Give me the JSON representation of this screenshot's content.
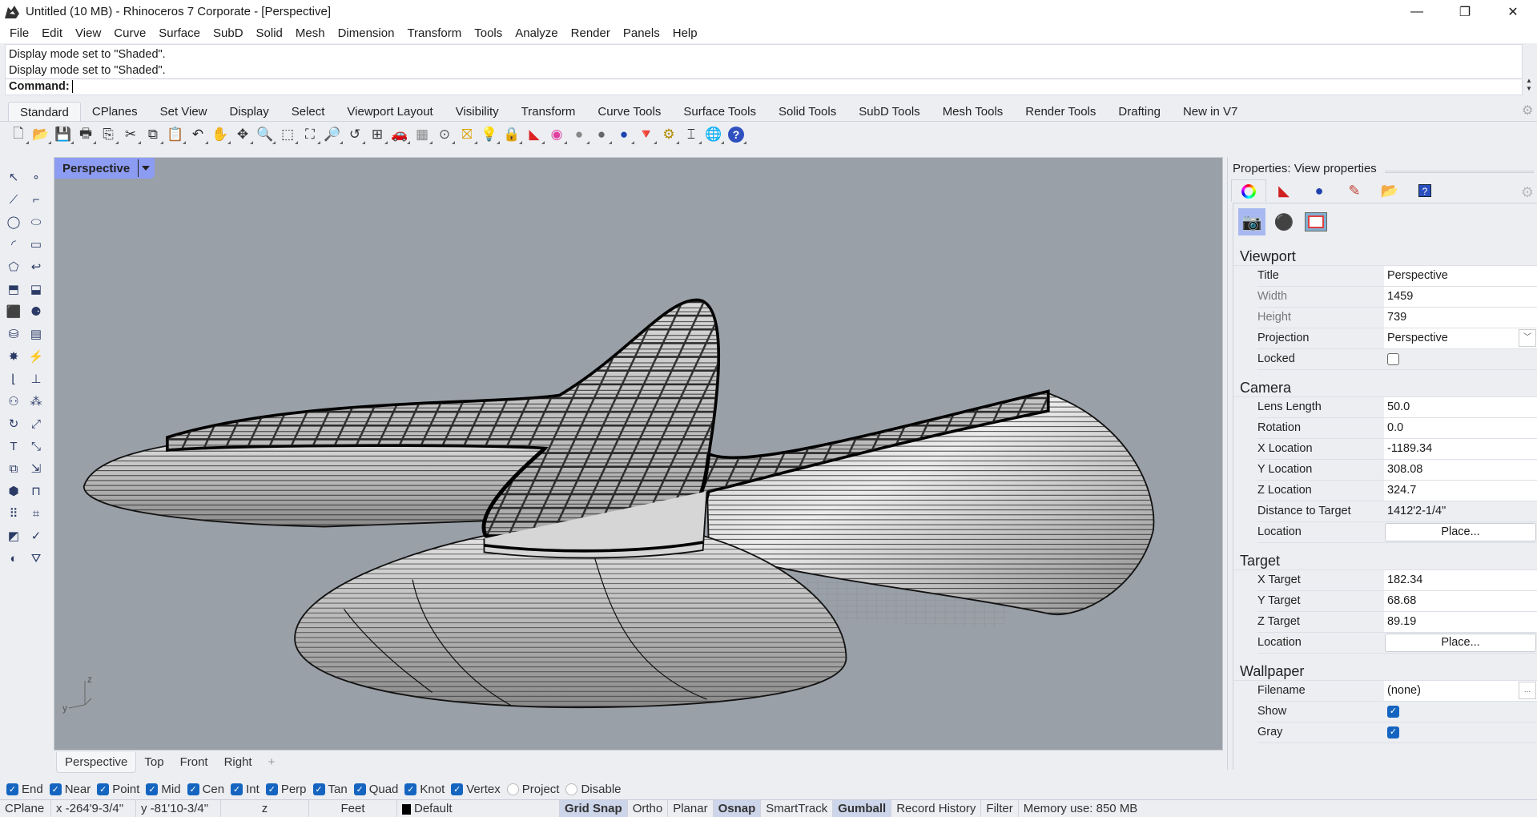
{
  "titlebar": {
    "title": "Untitled (10 MB) - Rhinoceros 7 Corporate - [Perspective]",
    "minimize": "—",
    "restore": "❐",
    "close": "✕"
  },
  "menu": [
    "File",
    "Edit",
    "View",
    "Curve",
    "Surface",
    "SubD",
    "Solid",
    "Mesh",
    "Dimension",
    "Transform",
    "Tools",
    "Analyze",
    "Render",
    "Panels",
    "Help"
  ],
  "command": {
    "history": [
      "Display mode set to \"Shaded\".",
      "Display mode set to \"Shaded\"."
    ],
    "prompt": "Command:",
    "value": ""
  },
  "toolbar_tabs": [
    "Standard",
    "CPlanes",
    "Set View",
    "Display",
    "Select",
    "Viewport Layout",
    "Visibility",
    "Transform",
    "Curve Tools",
    "Surface Tools",
    "Solid Tools",
    "SubD Tools",
    "Mesh Tools",
    "Render Tools",
    "Drafting",
    "New in V7"
  ],
  "toolbar_icons": [
    {
      "name": "new-file-icon",
      "g": "🗋",
      "c": "#555"
    },
    {
      "name": "open-folder-icon",
      "g": "📂",
      "c": "#d9a300"
    },
    {
      "name": "save-icon",
      "g": "💾",
      "c": "#7a6a2a"
    },
    {
      "name": "print-icon",
      "g": "🖶",
      "c": "#333"
    },
    {
      "name": "export-icon",
      "g": "⎘",
      "c": "#333"
    },
    {
      "name": "cut-icon",
      "g": "✂",
      "c": "#333"
    },
    {
      "name": "copy-icon",
      "g": "⧉",
      "c": "#333"
    },
    {
      "name": "paste-icon",
      "g": "📋",
      "c": "#d9b800"
    },
    {
      "name": "undo-icon",
      "g": "↶",
      "c": "#222"
    },
    {
      "name": "pan-icon",
      "g": "✋",
      "c": "#333"
    },
    {
      "name": "rotate-view-icon",
      "g": "✥",
      "c": "#333"
    },
    {
      "name": "zoom-dynamic-icon",
      "g": "🔍",
      "c": "#333"
    },
    {
      "name": "zoom-window-icon",
      "g": "⬚",
      "c": "#333"
    },
    {
      "name": "zoom-extents-icon",
      "g": "⛶",
      "c": "#333"
    },
    {
      "name": "zoom-selected-icon",
      "g": "🔎",
      "c": "#c9a000"
    },
    {
      "name": "undo-view-icon",
      "g": "↺",
      "c": "#333"
    },
    {
      "name": "four-viewports-icon",
      "g": "⊞",
      "c": "#333"
    },
    {
      "name": "car-icon",
      "g": "🚗",
      "c": "#d00"
    },
    {
      "name": "grid-icon",
      "g": "▦",
      "c": "#888"
    },
    {
      "name": "osnap-icon",
      "g": "⊙",
      "c": "#555"
    },
    {
      "name": "select-filter-icon",
      "g": "⛝",
      "c": "#d9a300"
    },
    {
      "name": "light-bulb-icon",
      "g": "💡",
      "c": "#777"
    },
    {
      "name": "lock-icon",
      "g": "🔒",
      "c": "#333"
    },
    {
      "name": "layer-icon",
      "g": "◣",
      "c": "#d22"
    },
    {
      "name": "color-wheel-icon",
      "g": "◉",
      "c": "#e040a0"
    },
    {
      "name": "shaded-sphere-icon",
      "g": "●",
      "c": "#888"
    },
    {
      "name": "rendered-sphere-icon",
      "g": "●",
      "c": "#666"
    },
    {
      "name": "render-icon",
      "g": "●",
      "c": "#1a45b0"
    },
    {
      "name": "spotlight-icon",
      "g": "🔻",
      "c": "#e08000"
    },
    {
      "name": "options-gear-icon",
      "g": "⚙",
      "c": "#b08a00"
    },
    {
      "name": "dimension-icon",
      "g": "⌶",
      "c": "#333"
    },
    {
      "name": "globe-icon",
      "g": "🌐",
      "c": "#3a7a2a"
    },
    {
      "name": "help-icon",
      "g": "?",
      "c": "#fff",
      "bg": "#3050c0"
    }
  ],
  "left_tools": [
    {
      "name": "select-arrow-icon",
      "g": "↖"
    },
    {
      "name": "point-icon",
      "g": "∘"
    },
    {
      "name": "polyline-icon",
      "g": "⟋"
    },
    {
      "name": "control-point-curve-icon",
      "g": "⌐"
    },
    {
      "name": "circle-icon",
      "g": "◯"
    },
    {
      "name": "ellipse-icon",
      "g": "⬭"
    },
    {
      "name": "arc-icon",
      "g": "◜"
    },
    {
      "name": "rectangle-icon",
      "g": "▭"
    },
    {
      "name": "polygon-icon",
      "g": "⬠"
    },
    {
      "name": "curve-from-objects-icon",
      "g": "↩"
    },
    {
      "name": "surface-from-points-icon",
      "g": "⬒"
    },
    {
      "name": "surface-tools-icon",
      "g": "⬓"
    },
    {
      "name": "box-icon",
      "g": "⬛"
    },
    {
      "name": "solid-tools-icon",
      "g": "⚈"
    },
    {
      "name": "cylinder-icon",
      "g": "⛁"
    },
    {
      "name": "mesh-icon",
      "g": "▤"
    },
    {
      "name": "explode-icon",
      "g": "✸"
    },
    {
      "name": "trim-icon",
      "g": "⚡"
    },
    {
      "name": "fillet-icon",
      "g": "⌊"
    },
    {
      "name": "join-icon",
      "g": "⊥"
    },
    {
      "name": "group-icon",
      "g": "⚇"
    },
    {
      "name": "array-icon",
      "g": "⁂"
    },
    {
      "name": "rotate-icon",
      "g": "↻"
    },
    {
      "name": "scale-icon",
      "g": "⤢"
    },
    {
      "name": "text-icon",
      "g": "T"
    },
    {
      "name": "dimension-tool-icon",
      "g": "⤡"
    },
    {
      "name": "block-icon",
      "g": "⧉"
    },
    {
      "name": "transform-tools-icon",
      "g": "⇲"
    },
    {
      "name": "render-box-icon",
      "g": "⬢"
    },
    {
      "name": "drafting-icon",
      "g": "⊓"
    },
    {
      "name": "array-grid-icon",
      "g": "⠿"
    },
    {
      "name": "analyze-icon",
      "g": "⌗"
    },
    {
      "name": "surface-analysis-icon",
      "g": "◩"
    },
    {
      "name": "check-icon",
      "g": "✓"
    },
    {
      "name": "hide-icon",
      "g": "◐"
    },
    {
      "name": "paint-icon",
      "g": "⛛"
    }
  ],
  "viewport": {
    "title": "Perspective",
    "axis": {
      "x": "",
      "y": "y",
      "z": "z"
    }
  },
  "view_tabs": [
    "Perspective",
    "Top",
    "Front",
    "Right"
  ],
  "view_tab_add": "+",
  "osnaps": [
    {
      "label": "End",
      "checked": true
    },
    {
      "label": "Near",
      "checked": true
    },
    {
      "label": "Point",
      "checked": true
    },
    {
      "label": "Mid",
      "checked": true
    },
    {
      "label": "Cen",
      "checked": true
    },
    {
      "label": "Int",
      "checked": true
    },
    {
      "label": "Perp",
      "checked": true
    },
    {
      "label": "Tan",
      "checked": true
    },
    {
      "label": "Quad",
      "checked": true
    },
    {
      "label": "Knot",
      "checked": true
    },
    {
      "label": "Vertex",
      "checked": true
    },
    {
      "label": "Project",
      "checked": false
    },
    {
      "label": "Disable",
      "checked": false
    }
  ],
  "status": {
    "cplane": "CPlane",
    "x": "x -264'9-3/4\"",
    "y": "y -81'10-3/4\"",
    "z": "z",
    "units": "Feet",
    "layer": "Default",
    "grid_snap": "Grid Snap",
    "ortho": "Ortho",
    "planar": "Planar",
    "osnap": "Osnap",
    "smarttrack": "SmartTrack",
    "gumball": "Gumball",
    "record_history": "Record History",
    "filter": "Filter",
    "memory": "Memory use: 850 MB"
  },
  "properties": {
    "header": "Properties: View properties",
    "viewport": {
      "heading": "Viewport",
      "title_label": "Title",
      "title": "Perspective",
      "width_label": "Width",
      "width": "1459",
      "height_label": "Height",
      "height": "739",
      "projection_label": "Projection",
      "projection": "Perspective",
      "locked_label": "Locked",
      "locked": false
    },
    "camera": {
      "heading": "Camera",
      "lens_label": "Lens Length",
      "lens": "50.0",
      "rotation_label": "Rotation",
      "rotation": "0.0",
      "xloc_label": "X Location",
      "xloc": "-1189.34",
      "yloc_label": "Y Location",
      "yloc": "308.08",
      "zloc_label": "Z Location",
      "zloc": "324.7",
      "dist_label": "Distance to Target",
      "dist": "1412'2-1/4\"",
      "location_label": "Location",
      "place": "Place..."
    },
    "target": {
      "heading": "Target",
      "x_label": "X Target",
      "x": "182.34",
      "y_label": "Y Target",
      "y": "68.68",
      "z_label": "Z Target",
      "z": "89.19",
      "location_label": "Location",
      "place": "Place..."
    },
    "wallpaper": {
      "heading": "Wallpaper",
      "filename_label": "Filename",
      "filename": "(none)",
      "browse": "...",
      "show_label": "Show",
      "show": true,
      "gray_label": "Gray",
      "gray": true
    }
  },
  "colors": {
    "viewport_bg": "#9aa0a7",
    "viewport_tab": "#8c9cf2",
    "accent": "#1565c0",
    "highlight": "#cdd5ea"
  }
}
